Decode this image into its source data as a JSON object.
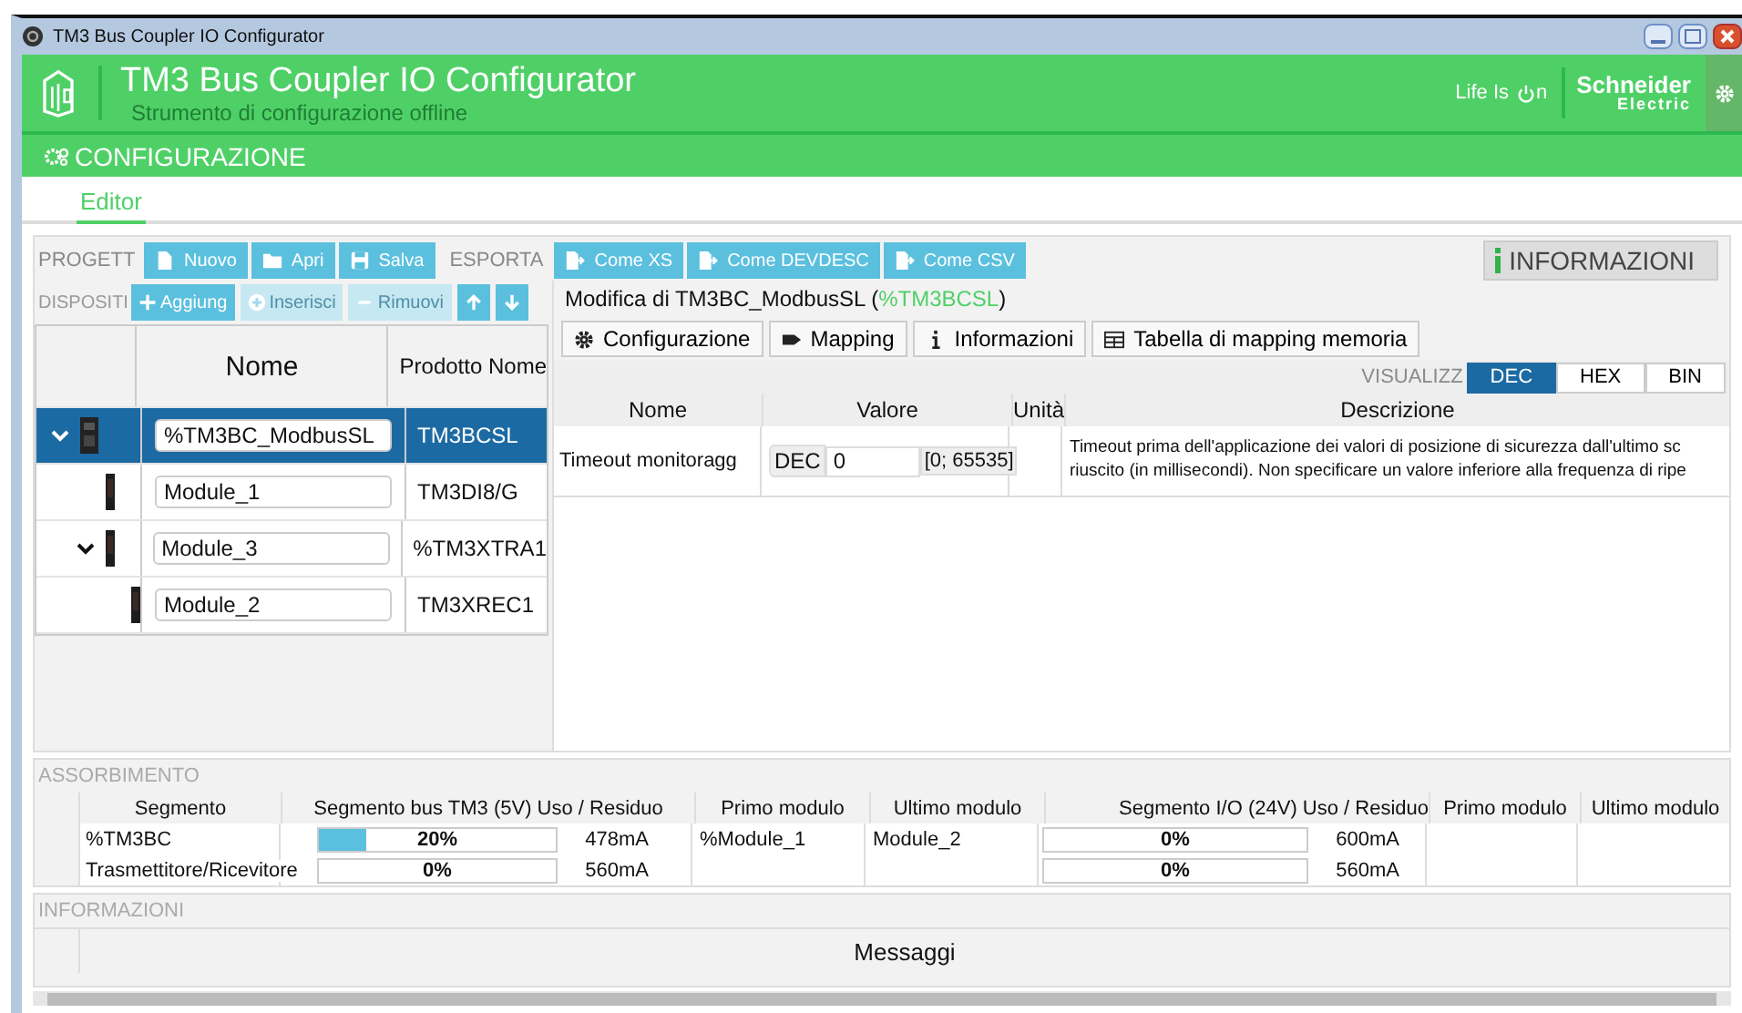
{
  "window": {
    "title": "TM3 Bus Coupler IO Configurator"
  },
  "header": {
    "title": "TM3 Bus Coupler IO Configurator",
    "subtitle": "Strumento di configurazione offline",
    "tagline_prefix": "Life Is",
    "tagline_suffix": "n",
    "brand_top": "Schneider",
    "brand_bottom": "Electric"
  },
  "section": {
    "title": "CONFIGURAZIONE"
  },
  "tabs": [
    {
      "label": "Editor",
      "selected": true
    }
  ],
  "toolbar": [
    {
      "kind": "label",
      "label": "PROGETT"
    },
    {
      "kind": "button",
      "label": "Nuovo"
    },
    {
      "kind": "button",
      "label": "Apri"
    },
    {
      "kind": "button",
      "label": "Salva"
    },
    {
      "kind": "label",
      "label": "ESPORTA"
    },
    {
      "kind": "button",
      "label": "Come XS"
    },
    {
      "kind": "button",
      "label": "Come DEVDESC"
    },
    {
      "kind": "button",
      "label": "Come CSV"
    }
  ],
  "info_button": {
    "label": "INFORMAZIONI"
  },
  "device_toolbar": [
    {
      "kind": "label",
      "label": "DISPOSITI"
    },
    {
      "kind": "button",
      "label": "Aggiung",
      "disabled": false
    },
    {
      "kind": "button",
      "label": "Inserisci",
      "disabled": true
    },
    {
      "kind": "button",
      "label": "Rimuovi",
      "disabled": true
    },
    {
      "kind": "move_up",
      "disabled": false
    },
    {
      "kind": "move_down",
      "disabled": false
    }
  ],
  "tree": {
    "columns": [
      "Nome",
      "Prodotto Nome"
    ],
    "rows": [
      {
        "name": "%TM3BC_ModbusSL",
        "product": "TM3BCSL",
        "selected": true,
        "expanded": true,
        "kind": "coupler",
        "children": [
          {
            "name": "Module_1",
            "product": "TM3DI8/G",
            "selected": false,
            "kind": "module"
          },
          {
            "name": "Module_3",
            "product": "%TM3XTRA1",
            "selected": false,
            "expanded": true,
            "kind": "module",
            "children": [
              {
                "name": "Module_2",
                "product": "TM3XREC1",
                "selected": false,
                "kind": "module"
              }
            ]
          }
        ]
      }
    ]
  },
  "editor": {
    "heading": "Modifica di TM3BC_ModbusSL (",
    "heading_ref": "%TM3BCSL",
    "heading_end": ")",
    "tabs": [
      {
        "label": "Configurazione"
      },
      {
        "label": "Mapping"
      },
      {
        "label": "Informazioni"
      },
      {
        "label": "Tabella di mapping memoria"
      }
    ],
    "view_label": "VISUALIZZ",
    "view_modes": [
      {
        "label": "DEC",
        "selected": true
      },
      {
        "label": "HEX",
        "selected": false
      },
      {
        "label": "BIN",
        "selected": false
      }
    ],
    "columns": [
      "Nome",
      "Valore",
      "Unità",
      "Descrizione"
    ],
    "rows": [
      {
        "name": "Timeout monitoragg",
        "format": "DEC",
        "value": "0",
        "range": "[0; 65535]",
        "description": [
          "Timeout prima dell'applicazione dei valori di posizione di sicurezza dall'ultimo sc",
          "riuscito (in millisecondi). Non specificare un valore inferiore alla frequenza di ripe"
        ]
      }
    ]
  },
  "consumption": {
    "title": "ASSORBIMENTO",
    "columns": [
      "Segmento",
      "Segmento bus TM3 (5V) Uso / Residuo",
      "Primo modulo",
      "Ultimo modulo",
      "Segmento I/O (24V) Uso / Residuo",
      "Primo modulo",
      "Ultimo modulo"
    ],
    "rows": [
      {
        "segment": "%TM3BC",
        "bus": {
          "level": 0.2,
          "percent": "20%",
          "current": "478mA"
        },
        "first": "%Module_1",
        "last": "Module_2",
        "io": {
          "level": 0,
          "percent": "0%",
          "current": "600mA"
        }
      },
      {
        "segment": "Trasmettitore/Ricevitore",
        "bus": {
          "level": 0,
          "percent": "0%",
          "current": "560mA"
        },
        "io": {
          "level": 0,
          "percent": "0%",
          "current": "560mA"
        }
      }
    ]
  },
  "messages": {
    "title": "INFORMAZIONI",
    "column": "Messaggi"
  }
}
